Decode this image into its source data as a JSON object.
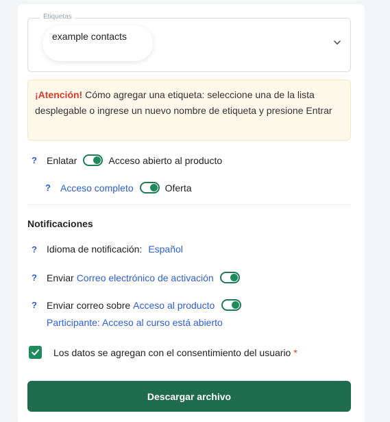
{
  "tags": {
    "legend": "Etiquetas",
    "chip": "example contacts"
  },
  "alert": {
    "strong": "¡Atención!",
    "text": " Cómo agregar una etiqueta: seleccione una de la lista desplegable o ingrese un nuevo nombre de etiqueta y presione Entrar"
  },
  "access": {
    "help": "?",
    "prefix": "Enlatar",
    "toggle_on": true,
    "label": "Acceso abierto al producto",
    "full_help": "?",
    "full_link": "Acceso completo",
    "full_toggle_on": true,
    "full_suffix": "Oferta"
  },
  "notifications": {
    "title": "Notificaciones",
    "language": {
      "help": "?",
      "label": "Idioma de notificación:",
      "value": "Español"
    },
    "activation": {
      "help": "?",
      "label": "Enviar",
      "link": "Correo electrónico de activación",
      "toggle_on": true
    },
    "product": {
      "help": "?",
      "label": "Enviar correo sobre",
      "link": "Acceso al producto",
      "toggle_on": true,
      "sub_link": "Participante: Acceso al curso está abierto"
    }
  },
  "consent": {
    "checked": true,
    "label": "Los datos se agregan con el consentimiento del usuario",
    "required_mark": "*"
  },
  "download_button": "Descargar archivo",
  "colors": {
    "accent_green": "#1f6b4d",
    "link_blue": "#2f5fd0",
    "alert_red": "#d93b2b",
    "alert_bg": "#fff9ec"
  }
}
